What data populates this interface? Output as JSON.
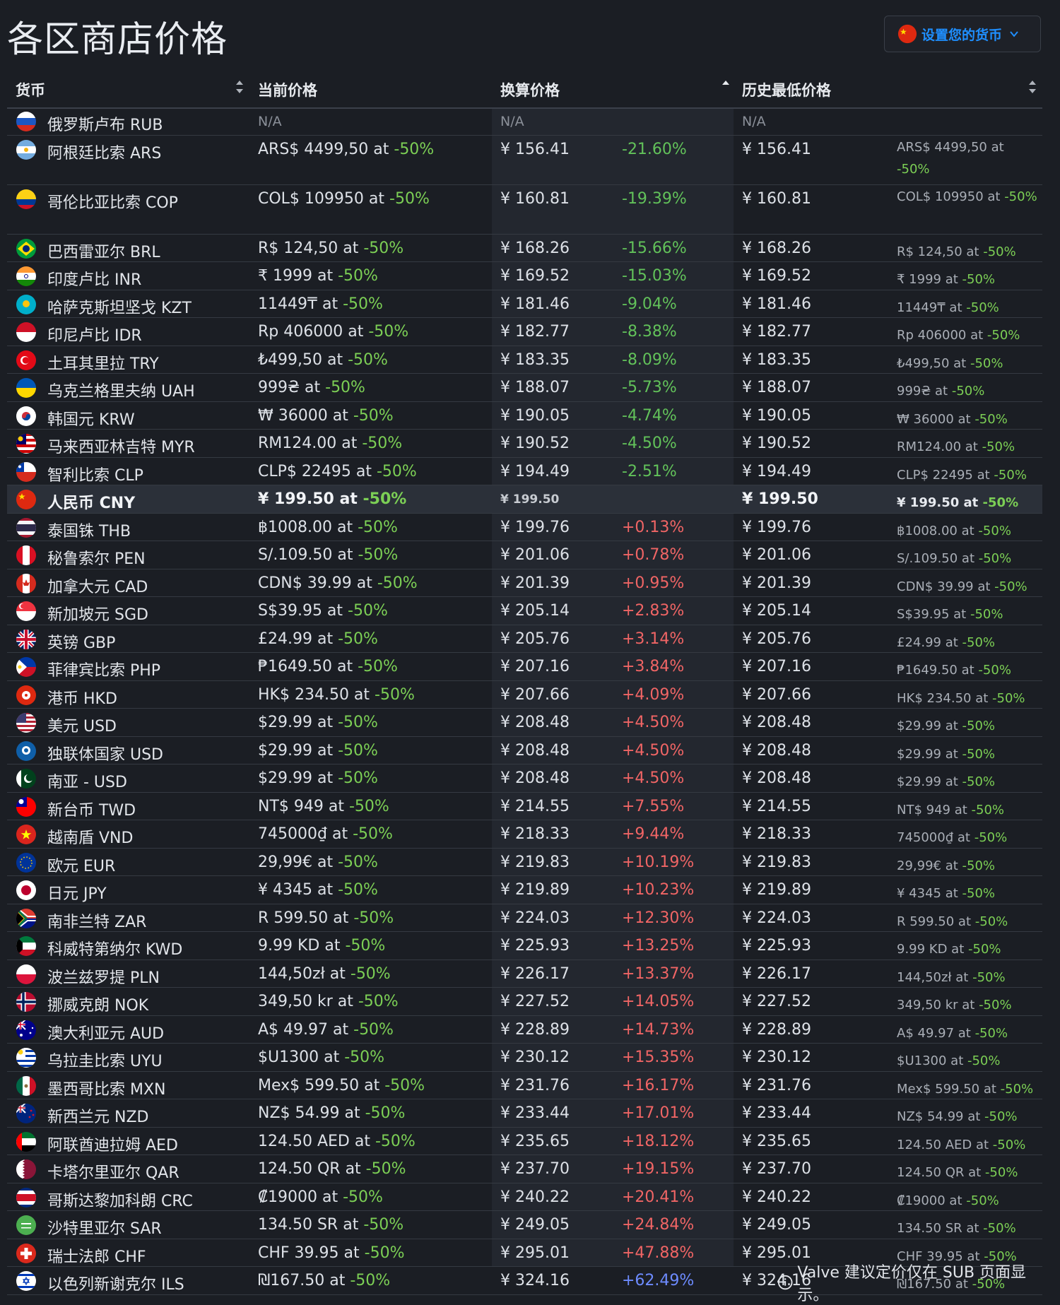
{
  "page": {
    "title": "各区商店价格",
    "currency_button": "设置您的货币",
    "footer_note": "Valve 建议定价仅在 SUB 页面显示。"
  },
  "colors": {
    "accent": "#1f8fff",
    "discount_green": "#7ccf55",
    "percent_negative": "#62c25a",
    "percent_positive": "#f06565",
    "percent_max": "#6d8bff",
    "background": "#1b1e24",
    "highlight_row": "#2b3039"
  },
  "table": {
    "headers": {
      "currency": "货币",
      "current_price": "当前价格",
      "converted_price": "换算价格",
      "lowest_price": "历史最低价格"
    },
    "rows": [
      {
        "flag": "russia",
        "name": "俄罗斯卢布 RUB",
        "na": true,
        "current": "N/A",
        "converted": "N/A",
        "lowest": "N/A"
      },
      {
        "flag": "argentina",
        "tall": true,
        "name": "阿根廷比索 ARS",
        "current": "ARS$ 4499,50 at ",
        "discount": "-50%",
        "converted": "¥ 156.41",
        "pct": "-21.60%",
        "lowest": "¥ 156.41",
        "lowest_price": "ARS$ 4499,50 at ",
        "lowest_discount": "-50%"
      },
      {
        "flag": "colombia",
        "tall": true,
        "name": "哥伦比亚比索 COP",
        "current": "COL$ 109950 at ",
        "discount": "-50%",
        "converted": "¥ 160.81",
        "pct": "-19.39%",
        "lowest": "¥ 160.81",
        "lowest_price": "COL$ 109950 at ",
        "lowest_discount": "-50%"
      },
      {
        "flag": "brazil",
        "name": "巴西雷亚尔 BRL",
        "current": "R$ 124,50 at ",
        "discount": "-50%",
        "converted": "¥ 168.26",
        "pct": "-15.66%",
        "lowest": "¥ 168.26",
        "lowest_price": "R$ 124,50 at ",
        "lowest_discount": "-50%"
      },
      {
        "flag": "india",
        "name": "印度卢比 INR",
        "current": "₹ 1999 at ",
        "discount": "-50%",
        "converted": "¥ 169.52",
        "pct": "-15.03%",
        "lowest": "¥ 169.52",
        "lowest_price": "₹ 1999 at ",
        "lowest_discount": "-50%"
      },
      {
        "flag": "kazakhstan",
        "name": "哈萨克斯坦坚戈 KZT",
        "current": "11449₸ at ",
        "discount": "-50%",
        "converted": "¥ 181.46",
        "pct": "-9.04%",
        "lowest": "¥ 181.46",
        "lowest_price": "11449₸ at ",
        "lowest_discount": "-50%"
      },
      {
        "flag": "indonesia",
        "name": "印尼卢比 IDR",
        "current": "Rp 406000 at ",
        "discount": "-50%",
        "converted": "¥ 182.77",
        "pct": "-8.38%",
        "lowest": "¥ 182.77",
        "lowest_price": "Rp 406000 at ",
        "lowest_discount": "-50%"
      },
      {
        "flag": "turkey",
        "name": "土耳其里拉 TRY",
        "current": "₺499,50 at ",
        "discount": "-50%",
        "converted": "¥ 183.35",
        "pct": "-8.09%",
        "lowest": "¥ 183.35",
        "lowest_price": "₺499,50 at ",
        "lowest_discount": "-50%"
      },
      {
        "flag": "ukraine",
        "name": "乌克兰格里夫纳 UAH",
        "current": "999₴ at ",
        "discount": "-50%",
        "converted": "¥ 188.07",
        "pct": "-5.73%",
        "lowest": "¥ 188.07",
        "lowest_price": "999₴ at ",
        "lowest_discount": "-50%"
      },
      {
        "flag": "korea",
        "name": "韩国元 KRW",
        "current": "₩ 36000 at ",
        "discount": "-50%",
        "converted": "¥ 190.05",
        "pct": "-4.74%",
        "lowest": "¥ 190.05",
        "lowest_price": "₩ 36000 at ",
        "lowest_discount": "-50%"
      },
      {
        "flag": "malaysia",
        "name": "马来西亚林吉特 MYR",
        "current": "RM124.00 at ",
        "discount": "-50%",
        "converted": "¥ 190.52",
        "pct": "-4.50%",
        "lowest": "¥ 190.52",
        "lowest_price": "RM124.00 at ",
        "lowest_discount": "-50%"
      },
      {
        "flag": "chile",
        "name": "智利比索 CLP",
        "current": "CLP$ 22495 at ",
        "discount": "-50%",
        "converted": "¥ 194.49",
        "pct": "-2.51%",
        "lowest": "¥ 194.49",
        "lowest_price": "CLP$ 22495 at ",
        "lowest_discount": "-50%"
      },
      {
        "flag": "china",
        "highlight": true,
        "name": "人民币 CNY",
        "current": "¥ 199.50 at ",
        "discount": "-50%",
        "converted": "¥ 199.50",
        "pct": "",
        "lowest": "¥ 199.50",
        "lowest_price": "¥ 199.50 at ",
        "lowest_discount": "-50%"
      },
      {
        "flag": "thailand",
        "name": "泰国铢 THB",
        "current": "฿1008.00 at ",
        "discount": "-50%",
        "converted": "¥ 199.76",
        "pct": "+0.13%",
        "lowest": "¥ 199.76",
        "lowest_price": "฿1008.00 at ",
        "lowest_discount": "-50%"
      },
      {
        "flag": "peru",
        "name": "秘鲁索尔 PEN",
        "current": "S/.109.50 at ",
        "discount": "-50%",
        "converted": "¥ 201.06",
        "pct": "+0.78%",
        "lowest": "¥ 201.06",
        "lowest_price": "S/.109.50 at ",
        "lowest_discount": "-50%"
      },
      {
        "flag": "canada",
        "name": "加拿大元 CAD",
        "current": "CDN$ 39.99 at ",
        "discount": "-50%",
        "converted": "¥ 201.39",
        "pct": "+0.95%",
        "lowest": "¥ 201.39",
        "lowest_price": "CDN$ 39.99 at ",
        "lowest_discount": "-50%"
      },
      {
        "flag": "singapore",
        "name": "新加坡元 SGD",
        "current": "S$39.95 at ",
        "discount": "-50%",
        "converted": "¥ 205.14",
        "pct": "+2.83%",
        "lowest": "¥ 205.14",
        "lowest_price": "S$39.95 at ",
        "lowest_discount": "-50%"
      },
      {
        "flag": "uk",
        "name": "英镑 GBP",
        "current": "£24.99 at ",
        "discount": "-50%",
        "converted": "¥ 205.76",
        "pct": "+3.14%",
        "lowest": "¥ 205.76",
        "lowest_price": "£24.99 at ",
        "lowest_discount": "-50%"
      },
      {
        "flag": "philippines",
        "name": "菲律宾比索 PHP",
        "current": "₱1649.50 at ",
        "discount": "-50%",
        "converted": "¥ 207.16",
        "pct": "+3.84%",
        "lowest": "¥ 207.16",
        "lowest_price": "₱1649.50 at ",
        "lowest_discount": "-50%"
      },
      {
        "flag": "hongkong",
        "name": "港币 HKD",
        "current": "HK$ 234.50 at ",
        "discount": "-50%",
        "converted": "¥ 207.66",
        "pct": "+4.09%",
        "lowest": "¥ 207.66",
        "lowest_price": "HK$ 234.50 at ",
        "lowest_discount": "-50%"
      },
      {
        "flag": "usa",
        "name": "美元 USD",
        "current": "$29.99 at ",
        "discount": "-50%",
        "converted": "¥ 208.48",
        "pct": "+4.50%",
        "lowest": "¥ 208.48",
        "lowest_price": "$29.99 at ",
        "lowest_discount": "-50%"
      },
      {
        "flag": "cis",
        "name": "独联体国家 USD",
        "current": "$29.99 at ",
        "discount": "-50%",
        "converted": "¥ 208.48",
        "pct": "+4.50%",
        "lowest": "¥ 208.48",
        "lowest_price": "$29.99 at ",
        "lowest_discount": "-50%"
      },
      {
        "flag": "pakistan",
        "name": "南亚 - USD",
        "current": "$29.99 at ",
        "discount": "-50%",
        "converted": "¥ 208.48",
        "pct": "+4.50%",
        "lowest": "¥ 208.48",
        "lowest_price": "$29.99 at ",
        "lowest_discount": "-50%"
      },
      {
        "flag": "taiwan",
        "name": "新台币 TWD",
        "current": "NT$ 949 at ",
        "discount": "-50%",
        "converted": "¥ 214.55",
        "pct": "+7.55%",
        "lowest": "¥ 214.55",
        "lowest_price": "NT$ 949 at ",
        "lowest_discount": "-50%"
      },
      {
        "flag": "vietnam",
        "name": "越南盾 VND",
        "current": "745000₫ at ",
        "discount": "-50%",
        "converted": "¥ 218.33",
        "pct": "+9.44%",
        "lowest": "¥ 218.33",
        "lowest_price": "745000₫ at ",
        "lowest_discount": "-50%"
      },
      {
        "flag": "eu",
        "name": "欧元 EUR",
        "current": "29,99€ at ",
        "discount": "-50%",
        "converted": "¥ 219.83",
        "pct": "+10.19%",
        "lowest": "¥ 219.83",
        "lowest_price": "29,99€ at ",
        "lowest_discount": "-50%"
      },
      {
        "flag": "japan",
        "name": "日元 JPY",
        "current": "¥ 4345 at ",
        "discount": "-50%",
        "converted": "¥ 219.89",
        "pct": "+10.23%",
        "lowest": "¥ 219.89",
        "lowest_price": "¥ 4345 at ",
        "lowest_discount": "-50%"
      },
      {
        "flag": "southafrica",
        "name": "南非兰特 ZAR",
        "current": "R 599.50 at ",
        "discount": "-50%",
        "converted": "¥ 224.03",
        "pct": "+12.30%",
        "lowest": "¥ 224.03",
        "lowest_price": "R 599.50 at ",
        "lowest_discount": "-50%"
      },
      {
        "flag": "kuwait",
        "name": "科威特第纳尔 KWD",
        "current": "9.99 KD at ",
        "discount": "-50%",
        "converted": "¥ 225.93",
        "pct": "+13.25%",
        "lowest": "¥ 225.93",
        "lowest_price": "9.99 KD at ",
        "lowest_discount": "-50%"
      },
      {
        "flag": "poland",
        "name": "波兰兹罗提 PLN",
        "current": "144,50zł at ",
        "discount": "-50%",
        "converted": "¥ 226.17",
        "pct": "+13.37%",
        "lowest": "¥ 226.17",
        "lowest_price": "144,50zł at ",
        "lowest_discount": "-50%"
      },
      {
        "flag": "norway",
        "name": "挪威克朗 NOK",
        "current": "349,50 kr at ",
        "discount": "-50%",
        "converted": "¥ 227.52",
        "pct": "+14.05%",
        "lowest": "¥ 227.52",
        "lowest_price": "349,50 kr at ",
        "lowest_discount": "-50%"
      },
      {
        "flag": "australia",
        "name": "澳大利亚元 AUD",
        "current": "A$ 49.97 at ",
        "discount": "-50%",
        "converted": "¥ 228.89",
        "pct": "+14.73%",
        "lowest": "¥ 228.89",
        "lowest_price": "A$ 49.97 at ",
        "lowest_discount": "-50%"
      },
      {
        "flag": "uruguay",
        "name": "乌拉圭比索 UYU",
        "current": "$U1300 at ",
        "discount": "-50%",
        "converted": "¥ 230.12",
        "pct": "+15.35%",
        "lowest": "¥ 230.12",
        "lowest_price": "$U1300 at ",
        "lowest_discount": "-50%"
      },
      {
        "flag": "mexico",
        "name": "墨西哥比索 MXN",
        "current": "Mex$ 599.50 at ",
        "discount": "-50%",
        "converted": "¥ 231.76",
        "pct": "+16.17%",
        "lowest": "¥ 231.76",
        "lowest_price": "Mex$ 599.50 at ",
        "lowest_discount": "-50%"
      },
      {
        "flag": "newzealand",
        "name": "新西兰元 NZD",
        "current": "NZ$ 54.99 at ",
        "discount": "-50%",
        "converted": "¥ 233.44",
        "pct": "+17.01%",
        "lowest": "¥ 233.44",
        "lowest_price": "NZ$ 54.99 at ",
        "lowest_discount": "-50%"
      },
      {
        "flag": "uae",
        "name": "阿联酋迪拉姆 AED",
        "current": "124.50 AED at ",
        "discount": "-50%",
        "converted": "¥ 235.65",
        "pct": "+18.12%",
        "lowest": "¥ 235.65",
        "lowest_price": "124.50 AED at ",
        "lowest_discount": "-50%"
      },
      {
        "flag": "qatar",
        "name": "卡塔尔里亚尔 QAR",
        "current": "124.50 QR at ",
        "discount": "-50%",
        "converted": "¥ 237.70",
        "pct": "+19.15%",
        "lowest": "¥ 237.70",
        "lowest_price": "124.50 QR at ",
        "lowest_discount": "-50%"
      },
      {
        "flag": "costarica",
        "name": "哥斯达黎加科朗 CRC",
        "current": "₡19000 at ",
        "discount": "-50%",
        "converted": "¥ 240.22",
        "pct": "+20.41%",
        "lowest": "¥ 240.22",
        "lowest_price": "₡19000 at ",
        "lowest_discount": "-50%"
      },
      {
        "flag": "saudi",
        "name": "沙特里亚尔 SAR",
        "current": "134.50 SR at ",
        "discount": "-50%",
        "converted": "¥ 249.05",
        "pct": "+24.84%",
        "lowest": "¥ 249.05",
        "lowest_price": "134.50 SR at ",
        "lowest_discount": "-50%"
      },
      {
        "flag": "switzerland",
        "name": "瑞士法郎 CHF",
        "current": "CHF 39.95 at ",
        "discount": "-50%",
        "converted": "¥ 295.01",
        "pct": "+47.88%",
        "lowest": "¥ 295.01",
        "lowest_price": "CHF 39.95 at ",
        "lowest_discount": "-50%"
      },
      {
        "flag": "israel",
        "max": true,
        "name": "以色列新谢克尔 ILS",
        "current": "₪167.50 at ",
        "discount": "-50%",
        "converted": "¥ 324.16",
        "pct": "+62.49%",
        "lowest": "¥ 324.16",
        "lowest_price": "₪167.50 at ",
        "lowest_discount": "-50%"
      }
    ]
  }
}
